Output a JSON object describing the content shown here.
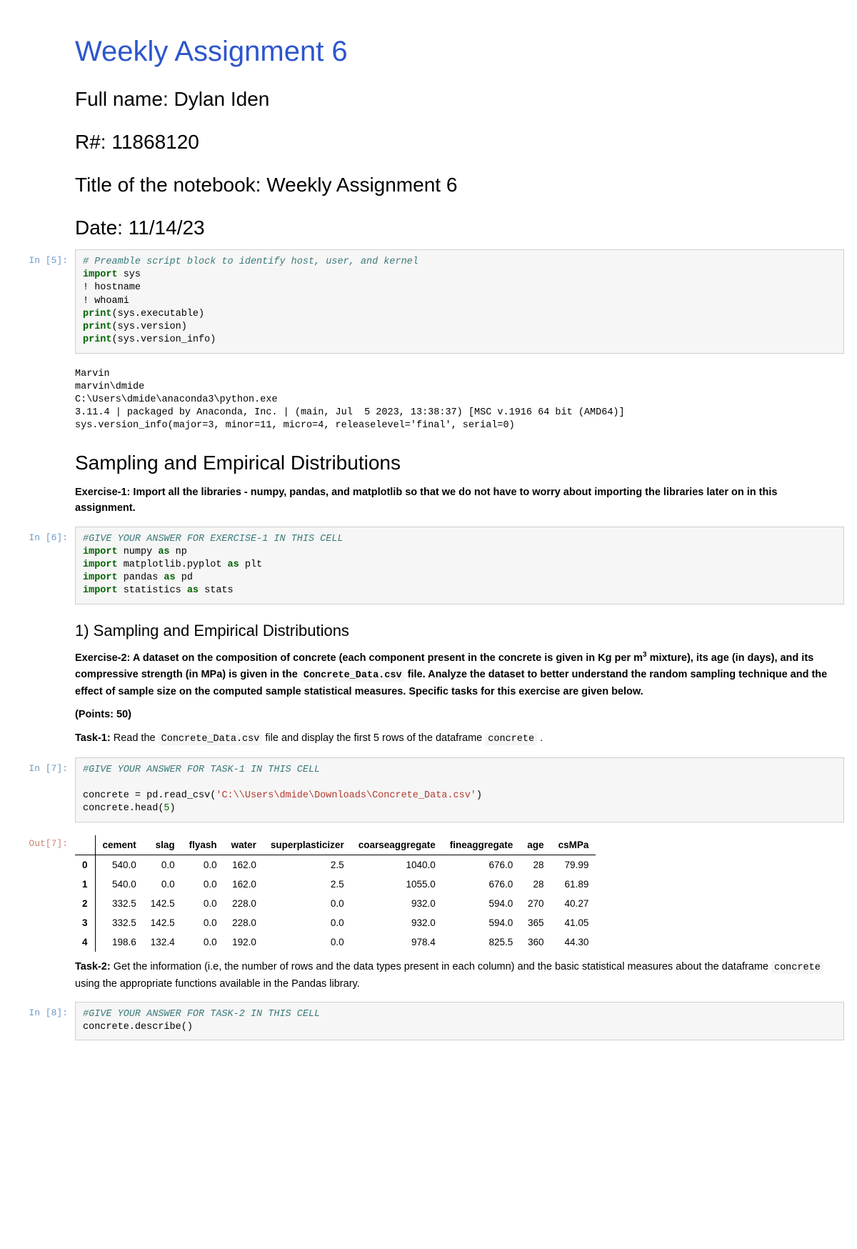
{
  "title": "Weekly Assignment 6",
  "hdr_name": "Full name: Dylan Iden",
  "hdr_rnum": "R#: 11868120",
  "hdr_nbtitle": "Title of the notebook: Weekly Assignment 6",
  "hdr_date": "Date: 11/14/23",
  "in5_prompt": "In [5]:",
  "in6_prompt": "In [6]:",
  "in7_prompt": "In [7]:",
  "out7_prompt": "Out[7]:",
  "in8_prompt": "In [8]:",
  "cell5": {
    "c0": "# Preamble script block to identify host, user, and kernel",
    "l1k": "import",
    "l1r": " sys",
    "l2": "! hostname",
    "l3": "! whoami",
    "l4a": "print",
    "l4b": "(sys.executable)",
    "l5a": "print",
    "l5b": "(sys.version)",
    "l6a": "print",
    "l6b": "(sys.version_info)"
  },
  "out5_text": "Marvin\nmarvin\\dmide\nC:\\Users\\dmide\\anaconda3\\python.exe\n3.11.4 | packaged by Anaconda, Inc. | (main, Jul  5 2023, 13:38:37) [MSC v.1916 64 bit (AMD64)]\nsys.version_info(major=3, minor=11, micro=4, releaselevel='final', serial=0)",
  "section1": "Sampling and Empirical Distributions",
  "ex1": "Exercise-1: Import all the libraries - numpy, pandas, and matplotlib so that we do not have to worry about importing the libraries later on in this assignment.",
  "cell6": {
    "c0": "#GIVE YOUR ANSWER FOR EXERCISE-1 IN THIS CELL",
    "kw": "import",
    "as": "as",
    "l1a": " numpy ",
    "l1b": " np",
    "l2a": " matplotlib.pyplot ",
    "l2b": " plt",
    "l3a": " pandas ",
    "l3b": " pd",
    "l4a": " statistics ",
    "l4b": " stats"
  },
  "section2": "1) Sampling and Empirical Distributions",
  "ex2_a": "Exercise-2: A dataset on the composition of concrete (each component present in the concrete is given in Kg per m",
  "ex2_sup": "3",
  "ex2_b": " mixture), its age (in days), and its compressive strength (in MPa) is given in the ",
  "ex2_code": "Concrete_Data.csv",
  "ex2_c": " file. Analyze the dataset to better understand the random sampling technique and the effect of sample size on the computed sample statistical measures. Specific tasks for this exercise are given below.",
  "points": "(Points: 50)",
  "task1_a": "Task-1:",
  "task1_b": " Read the ",
  "task1_code1": "Concrete_Data.csv",
  "task1_c": " file and display the first 5 rows of the dataframe ",
  "task1_code2": "concrete",
  "task1_d": " .",
  "cell7": {
    "c0": "#GIVE YOUR ANSWER FOR TASK-1 IN THIS CELL",
    "l2a": "concrete = pd.read_csv(",
    "l2s": "'C:\\\\Users\\dmide\\Downloads\\Concrete_Data.csv'",
    "l2b": ")",
    "l3a": "concrete.head(",
    "l3n": "5",
    "l3b": ")"
  },
  "df": {
    "cols": [
      "cement",
      "slag",
      "flyash",
      "water",
      "superplasticizer",
      "coarseaggregate",
      "fineaggregate",
      "age",
      "csMPa"
    ],
    "idx": [
      "0",
      "1",
      "2",
      "3",
      "4"
    ],
    "rows": [
      [
        "540.0",
        "0.0",
        "0.0",
        "162.0",
        "2.5",
        "1040.0",
        "676.0",
        "28",
        "79.99"
      ],
      [
        "540.0",
        "0.0",
        "0.0",
        "162.0",
        "2.5",
        "1055.0",
        "676.0",
        "28",
        "61.89"
      ],
      [
        "332.5",
        "142.5",
        "0.0",
        "228.0",
        "0.0",
        "932.0",
        "594.0",
        "270",
        "40.27"
      ],
      [
        "332.5",
        "142.5",
        "0.0",
        "228.0",
        "0.0",
        "932.0",
        "594.0",
        "365",
        "41.05"
      ],
      [
        "198.6",
        "132.4",
        "0.0",
        "192.0",
        "0.0",
        "978.4",
        "825.5",
        "360",
        "44.30"
      ]
    ]
  },
  "task2_a": "Task-2:",
  "task2_b": " Get the information (i.e, the number of rows and the data types present in each column) and the basic statistical measures about the dataframe ",
  "task2_code": "concrete",
  "task2_c": " using the appropriate functions available in the Pandas library.",
  "cell8": {
    "c0": "#GIVE YOUR ANSWER FOR TASK-2 IN THIS CELL",
    "l2": "concrete.describe()"
  }
}
